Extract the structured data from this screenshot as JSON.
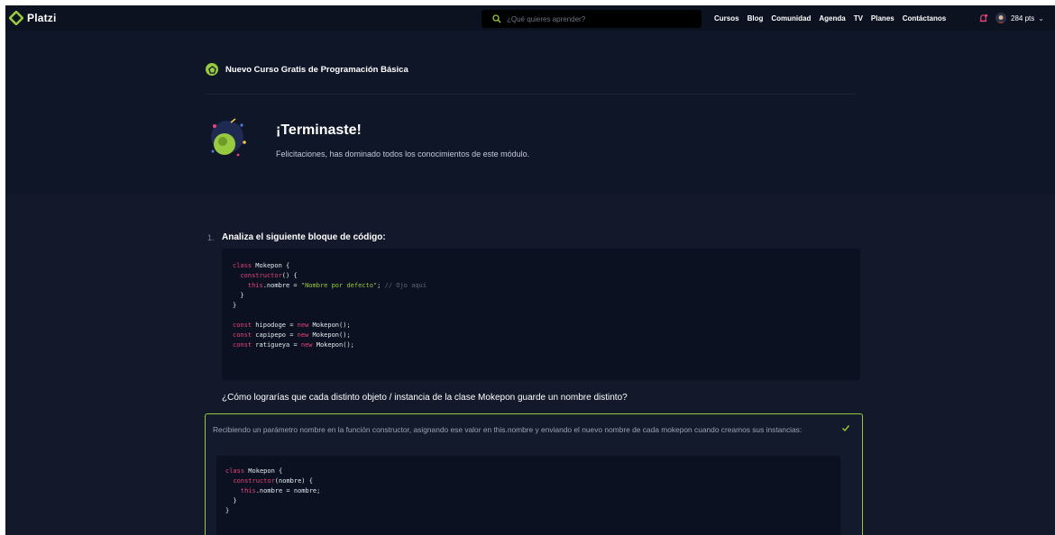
{
  "navbar": {
    "brand": "Platzi",
    "search_placeholder": "¿Qué quieres aprender?",
    "links": [
      "Cursos",
      "Blog",
      "Comunidad",
      "Agenda",
      "TV",
      "Planes",
      "Contáctanos"
    ],
    "points": "284 pts"
  },
  "course": {
    "title": "Nuevo Curso Gratis de Programación Básica"
  },
  "completion": {
    "title": "¡Terminaste!",
    "subtitle": "Felicitaciones, has dominado todos los conocimientos de este módulo."
  },
  "question": {
    "number": "1.",
    "prompt": "Analiza el siguiente bloque de código:",
    "code_lines": [
      [
        {
          "t": "class ",
          "c": "k"
        },
        {
          "t": "Mokepon {",
          "c": ""
        }
      ],
      [
        {
          "t": "  ",
          "c": ""
        },
        {
          "t": "constructor",
          "c": "k"
        },
        {
          "t": "() {",
          "c": ""
        }
      ],
      [
        {
          "t": "    ",
          "c": ""
        },
        {
          "t": "this",
          "c": "k"
        },
        {
          "t": ".nombre = ",
          "c": ""
        },
        {
          "t": "\"Nombre por defecto\"",
          "c": "s"
        },
        {
          "t": "; ",
          "c": ""
        },
        {
          "t": "// Ojo aquí",
          "c": "c"
        }
      ],
      [
        {
          "t": "  }",
          "c": ""
        }
      ],
      [
        {
          "t": "}",
          "c": ""
        }
      ],
      [
        {
          "t": "",
          "c": ""
        }
      ],
      [
        {
          "t": "const ",
          "c": "k"
        },
        {
          "t": "hipodoge = ",
          "c": ""
        },
        {
          "t": "new ",
          "c": "k"
        },
        {
          "t": "Mokepon();",
          "c": ""
        }
      ],
      [
        {
          "t": "const ",
          "c": "k"
        },
        {
          "t": "capipepo = ",
          "c": ""
        },
        {
          "t": "new ",
          "c": "k"
        },
        {
          "t": "Mokepon();",
          "c": ""
        }
      ],
      [
        {
          "t": "const ",
          "c": "k"
        },
        {
          "t": "ratigueya = ",
          "c": ""
        },
        {
          "t": "new ",
          "c": "k"
        },
        {
          "t": "Mokepon();",
          "c": ""
        }
      ]
    ],
    "ask": "¿Cómo lograrías que cada distinto objeto / instancia de la clase Mokepon guarde un nombre distinto?"
  },
  "answer": {
    "text": "Recibiendo un parámetro nombre en la función constructor, asignando ese valor en this.nombre y enviando el nuevo nombre de cada mokepon cuando creamos sus instancias:",
    "code_lines": [
      [
        {
          "t": "class ",
          "c": "k"
        },
        {
          "t": "Mokepon {",
          "c": ""
        }
      ],
      [
        {
          "t": "  ",
          "c": ""
        },
        {
          "t": "constructor",
          "c": "k"
        },
        {
          "t": "(nombre) {",
          "c": ""
        }
      ],
      [
        {
          "t": "    ",
          "c": ""
        },
        {
          "t": "this",
          "c": "k"
        },
        {
          "t": ".nombre = nombre;",
          "c": ""
        }
      ],
      [
        {
          "t": "  }",
          "c": ""
        }
      ],
      [
        {
          "t": "}",
          "c": ""
        }
      ]
    ],
    "status": "correct"
  },
  "colors": {
    "accent": "#98ca3f",
    "keyword": "#e8437a",
    "background": "#13192a"
  }
}
